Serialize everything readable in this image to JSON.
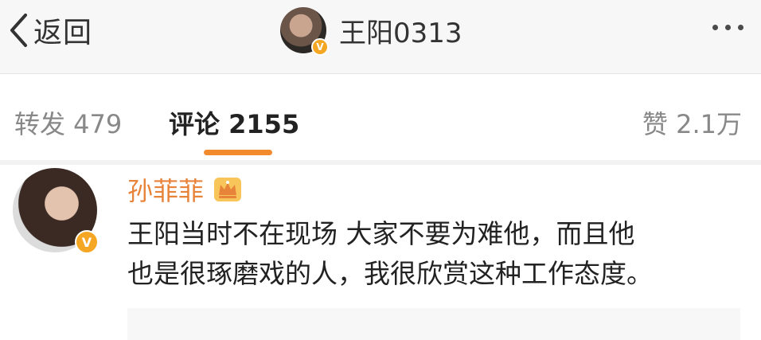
{
  "header": {
    "back_label": "返回",
    "title": "王阳0313",
    "verified_badge": "V"
  },
  "tabs": {
    "repost": "转发 479",
    "comment": "评论 2155",
    "like": "赞 2.1万",
    "active": "comment"
  },
  "comment": {
    "username": "孙菲菲",
    "verified_badge": "V",
    "lines": [
      "王阳当时不在现场 大家不要为难他，而且他",
      "也是很琢磨戏的人，我很欣赏这种工作态度。"
    ]
  },
  "colors": {
    "accent": "#f28b2d",
    "username": "#e8833a",
    "verified": "#f5a623",
    "header_bg": "#f7f7f7"
  },
  "icons": {
    "back": "chevron-left-icon",
    "more": "more-dots-icon",
    "crown": "crown-icon"
  }
}
